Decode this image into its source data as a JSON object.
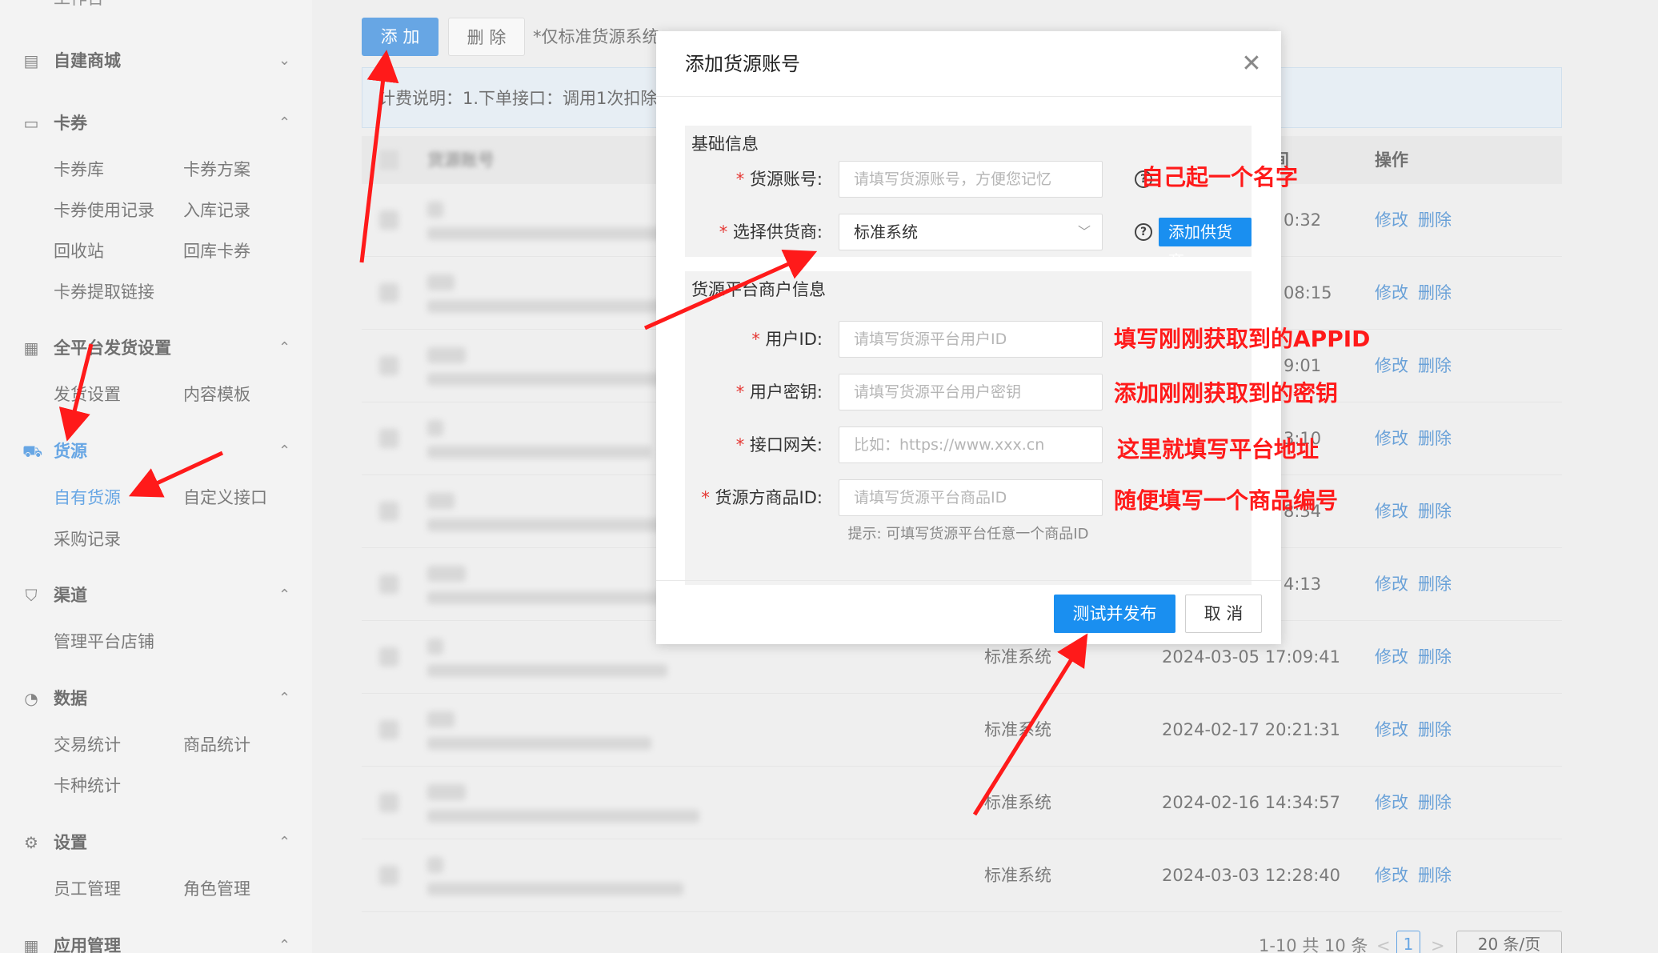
{
  "sidebar": {
    "top_partial": "工作台",
    "sections": [
      {
        "label": "自建商城",
        "icon": "store-icon",
        "expanded": false
      },
      {
        "label": "卡券",
        "icon": "card-icon",
        "expanded": true
      },
      {
        "label": "全平台发货设置",
        "icon": "grid-icon",
        "expanded": true
      },
      {
        "label": "货源",
        "icon": "cart-icon",
        "expanded": true
      },
      {
        "label": "渠道",
        "icon": "bag-icon",
        "expanded": true
      },
      {
        "label": "数据",
        "icon": "pie-icon",
        "expanded": true
      },
      {
        "label": "设置",
        "icon": "gear-icon",
        "expanded": true
      },
      {
        "label": "应用管理",
        "icon": "apps-icon",
        "expanded": true
      }
    ],
    "items": {
      "card_library": "卡券库",
      "card_plan": "卡券方案",
      "card_usage": "卡券使用记录",
      "stock_in": "入库记录",
      "recycle_bin": "回收站",
      "return_card": "回库卡券",
      "card_link": "卡券提取链接",
      "ship_settings": "发货设置",
      "content_template": "内容模板",
      "own_supply": "自有货源",
      "custom_api": "自定义接口",
      "purchase_record": "采购记录",
      "manage_shops": "管理平台店铺",
      "trade_stats": "交易统计",
      "product_stats": "商品统计",
      "card_type_stats": "卡种统计",
      "staff_mgmt": "员工管理",
      "role_mgmt": "角色管理"
    },
    "active_item": "自有货源"
  },
  "main": {
    "add_btn": "添 加",
    "delete_btn": "删 除",
    "note": "*仅标准货源系统",
    "billing": "计费说明：1.下单接口：调用1次扣除",
    "col_account": "货源账号",
    "col_time_partial": "间",
    "col_ops": "操作",
    "rows": [
      {
        "supplier": "",
        "time": "0:32",
        "edit": "修改",
        "delete": "删除"
      },
      {
        "supplier": "",
        "time": "08:15",
        "edit": "修改",
        "delete": "删除"
      },
      {
        "supplier": "",
        "time": "9:01",
        "edit": "修改",
        "delete": "删除"
      },
      {
        "supplier": "",
        "time": "3:10",
        "edit": "修改",
        "delete": "删除"
      },
      {
        "supplier": "",
        "time": "8:34",
        "edit": "修改",
        "delete": "删除"
      },
      {
        "supplier": "",
        "time": "4:13",
        "edit": "修改",
        "delete": "删除"
      },
      {
        "supplier": "标准系统",
        "time": "2024-03-05 17:09:41",
        "edit": "修改",
        "delete": "删除"
      },
      {
        "supplier": "标准系统",
        "time": "2024-02-17 20:21:31",
        "edit": "修改",
        "delete": "删除"
      },
      {
        "supplier": "标准系统",
        "time": "2024-02-16 14:34:57",
        "edit": "修改",
        "delete": "删除"
      },
      {
        "supplier": "标准系统",
        "time": "2024-03-03 12:28:40",
        "edit": "修改",
        "delete": "删除"
      }
    ],
    "pager": {
      "summary": "1-10 共 10 条",
      "prev": "<",
      "page": "1",
      "next": ">",
      "page_size": "20 条/页"
    }
  },
  "modal": {
    "title": "添加货源账号",
    "section_basic": "基础信息",
    "account_label": "货源账号:",
    "account_placeholder": "请填写货源账号，方便您记忆",
    "supplier_label": "选择供货商:",
    "supplier_value": "标准系统",
    "add_supplier_btn": "添加供货商",
    "section_merchant": "货源平台商户信息",
    "userid_label": "用户ID:",
    "userid_placeholder": "请填写货源平台用户ID",
    "secret_label": "用户密钥:",
    "secret_placeholder": "请填写货源平台用户密钥",
    "gateway_label": "接口网关:",
    "gateway_placeholder": "比如：https://www.xxx.cn",
    "product_label": "货源方商品ID:",
    "product_placeholder": "请填写货源平台商品ID",
    "hint": "提示: 可填写货源平台任意一个商品ID",
    "publish_btn": "测试并发布",
    "cancel_btn": "取 消"
  },
  "annotations": {
    "name": "自己起一个名字",
    "appid": "填写刚刚获取到的APPID",
    "secret": "添加刚刚获取到的密钥",
    "address": "这里就填写平台地址",
    "product": "随便填写一个商品编号",
    "color": "#ff1a1a"
  },
  "colors": {
    "accent": "#1a8ff0",
    "link": "#1a6fc4",
    "required": "#e53935"
  }
}
